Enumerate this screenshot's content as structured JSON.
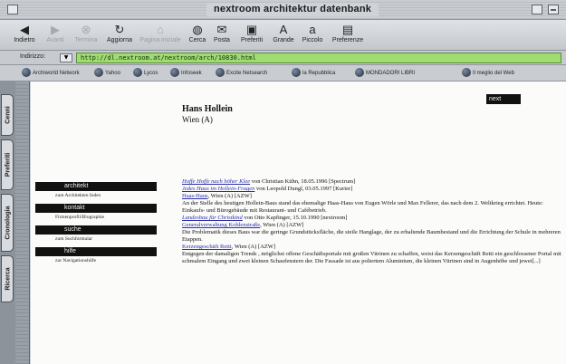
{
  "window": {
    "title": "nextroom architektur datenbank"
  },
  "toolbar": {
    "buttons": [
      {
        "label": "Indietro",
        "icon": "back-arrow-icon",
        "glyph": "◀",
        "enabled": true
      },
      {
        "label": "Avanti",
        "icon": "forward-arrow-icon",
        "glyph": "▶",
        "enabled": false
      },
      {
        "label": "Termina",
        "icon": "stop-icon",
        "glyph": "⊗",
        "enabled": false
      },
      {
        "label": "Aggiorna",
        "icon": "reload-icon",
        "glyph": "↻",
        "enabled": true
      },
      {
        "label": "Pagina iniziale",
        "icon": "home-icon",
        "glyph": "⌂",
        "enabled": false
      },
      {
        "label": "Cerca",
        "icon": "search-icon",
        "glyph": "◍",
        "enabled": true
      },
      {
        "label": "Posta",
        "icon": "mail-icon",
        "glyph": "✉",
        "enabled": true
      },
      {
        "label": "Preferiti",
        "icon": "favorites-icon",
        "glyph": "▣",
        "enabled": true
      },
      {
        "label": "Grande",
        "icon": "larger-text-icon",
        "glyph": "A",
        "enabled": true
      },
      {
        "label": "Piccolo",
        "icon": "smaller-text-icon",
        "glyph": "a",
        "enabled": true
      },
      {
        "label": "Preferenze",
        "icon": "preferences-icon",
        "glyph": "▤",
        "enabled": true
      }
    ]
  },
  "address": {
    "label": "Indirizzo:",
    "url": "http://dl.nextroom.at/nextroom/arch/10830.html"
  },
  "favorites": [
    "Archiworld Network",
    "Yahoo",
    "Lycos",
    "Infoseek",
    "Excite Netsearch",
    "la Repubblica",
    "MONDADORI LIBRI",
    "Il meglio del Web"
  ],
  "sidetabs": [
    "Cenni",
    "Preferiti",
    "Cronologia",
    "Ricerca"
  ],
  "page": {
    "next_label": "next",
    "architect_name": "Hans Hollein",
    "architect_location": "Wien (A)",
    "menu": [
      {
        "label": "architekt",
        "sub": "zum Architekten Index"
      },
      {
        "label": "kontakt",
        "sub": "Firmenprofil/Biographie"
      },
      {
        "label": "suche",
        "sub": "zum Suchformular"
      },
      {
        "label": "hilfe",
        "sub": "zur Navigationshilfe"
      }
    ],
    "entries": [
      {
        "link": "Hoffe Hoffe nach höher Klee",
        "text": " von Christian Kühn, 18.05.1996 [Spectrum]",
        "italic": true
      },
      {
        "link": "Jedes Haus im Hollein-Fragen",
        "text": " von Leopold Dungl, 03.05.1997 [Kurier]",
        "italic": true
      },
      {
        "link": "Haas-Haus",
        "text": ", Wien (A) [AZW]",
        "italic": false
      },
      {
        "desc": "An der Stelle des heutigen Hollein-Baus stand das ehemalige Haas-Haus von Eugen Wörle und Max Fellerer, das nach dem 2. Weltkrieg errichtet. Heute: Einkaufs- und Bürogebäude mit Restaurant- und Cafébetrieb."
      },
      {
        "link": "Landesbau für Christkind",
        "text": " von Otto Kapfinger, 15.10.1990 [nextroom]",
        "italic": true
      },
      {
        "link": "Generalverwaltung Kohlenstraße",
        "text": ", Wien (A) [AZW]",
        "italic": false
      },
      {
        "desc": "Die Problematik dieses Baus war die geringe Grundstücksfläche, die steile Hanglage, der zu erhaltende Baumbestand und die Errichtung der Schule in mehreren Etappen."
      },
      {
        "link": "Kerzengeschäft Retti",
        "text": ", Wien (A) [AZW]",
        "italic": false
      },
      {
        "desc": "Entgegen der damaligen Trends , möglichst offene Geschäftsportale mit großen Vitrinen zu schaffen, weist das Kerzengeschäft Retti ein geschlossener Portal mit schmalem Eingang und zwei kleinen Schaufenstern der. Die Fassade ist aus poliertem Aluminium, die kleinen Vitrinen sind in Augenhöhe und jewei[...]"
      }
    ]
  }
}
